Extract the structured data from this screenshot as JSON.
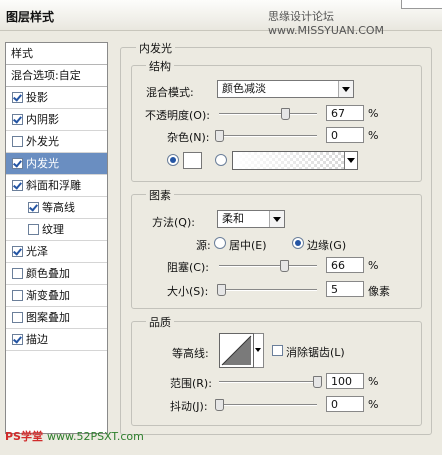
{
  "window": {
    "title": "图层样式",
    "watermark": "思缘设计论坛 www.MISSYUAN.COM"
  },
  "sidebar": {
    "header": "样式",
    "blend_options": "混合选项:自定",
    "items": [
      {
        "label": "投影",
        "checked": true
      },
      {
        "label": "内阴影",
        "checked": true
      },
      {
        "label": "外发光",
        "checked": false
      },
      {
        "label": "内发光",
        "checked": true,
        "selected": true
      },
      {
        "label": "斜面和浮雕",
        "checked": true
      },
      {
        "label": "等高线",
        "checked": true,
        "indent": true
      },
      {
        "label": "纹理",
        "checked": false,
        "indent": true
      },
      {
        "label": "光泽",
        "checked": true
      },
      {
        "label": "颜色叠加",
        "checked": false
      },
      {
        "label": "渐变叠加",
        "checked": false
      },
      {
        "label": "图案叠加",
        "checked": false
      },
      {
        "label": "描边",
        "checked": true
      }
    ]
  },
  "panel": {
    "title": "内发光",
    "structure": {
      "legend": "结构",
      "blend_mode_label": "混合模式:",
      "blend_mode_value": "颜色减淡",
      "opacity_label": "不透明度(O):",
      "opacity_value": "67",
      "opacity_level": 67,
      "percent": "%",
      "noise_label": "杂色(N):",
      "noise_value": "0",
      "noise_level": 0,
      "color_swatch": "#ffffff"
    },
    "elements": {
      "legend": "图素",
      "method_label": "方法(Q):",
      "method_value": "柔和",
      "source_label": "源:",
      "source_center": "居中(E)",
      "source_edge": "边缘(G)",
      "choke_label": "阻塞(C):",
      "choke_value": "66",
      "choke_level": 66,
      "size_label": "大小(S):",
      "size_value": "5",
      "size_unit": "像素",
      "size_level": 2
    },
    "quality": {
      "legend": "品质",
      "contour_label": "等高线:",
      "antialias_label": "消除锯齿(L)",
      "range_label": "范围(R):",
      "range_value": "100",
      "range_level": 100,
      "jitter_label": "抖动(J):",
      "jitter_value": "0",
      "jitter_level": 0
    }
  },
  "footer": {
    "logo": "PS学堂",
    "url": "www.52PSXT.com"
  }
}
